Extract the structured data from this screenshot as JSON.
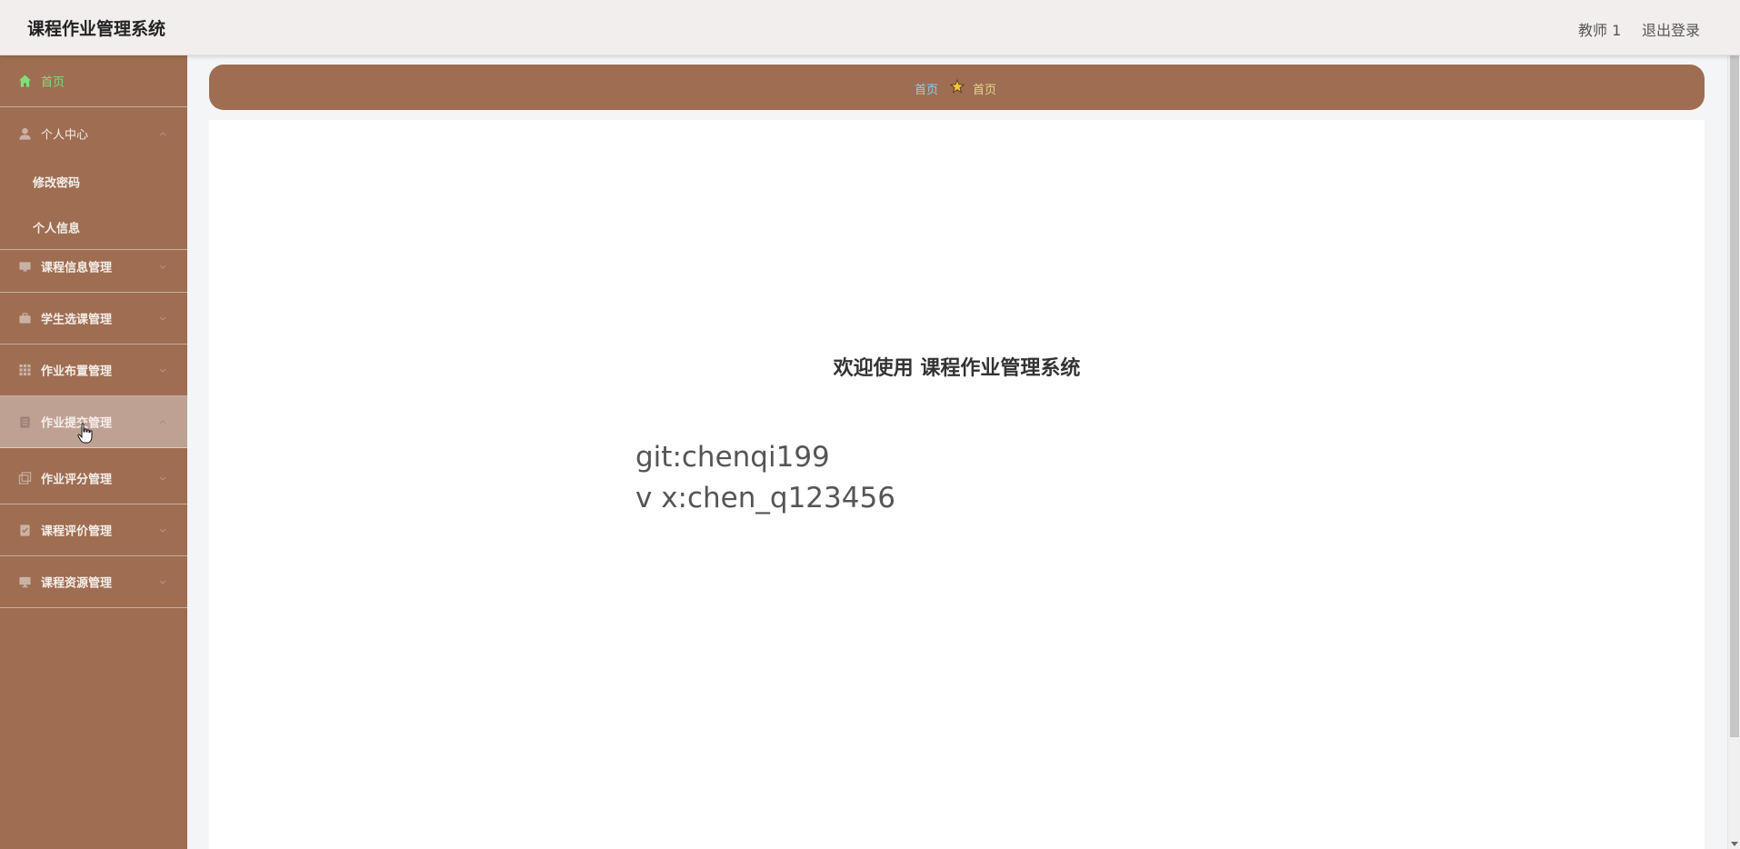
{
  "header": {
    "app_title": "课程作业管理系统",
    "user": "教师 1",
    "logout": "退出登录"
  },
  "sidebar": {
    "home": "首页",
    "personal_center": "个人中心",
    "change_password": "修改密码",
    "personal_info": "个人信息",
    "course_info": "课程信息管理",
    "course_selection": "学生选课管理",
    "assignment_publish": "作业布置管理",
    "assignment_submit": "作业提交管理",
    "assignment_grading": "作业评分管理",
    "course_evaluation": "课程评价管理",
    "course_resources": "课程资源管理"
  },
  "breadcrumb": {
    "first": "首页",
    "second": "首页"
  },
  "main": {
    "welcome": "欢迎使用 课程作业管理系统",
    "line1": "git:chenqi199",
    "line2": "v x:chen_q123456"
  },
  "colors": {
    "sidebar": "#9e6d52",
    "active": "#7fe07a"
  }
}
